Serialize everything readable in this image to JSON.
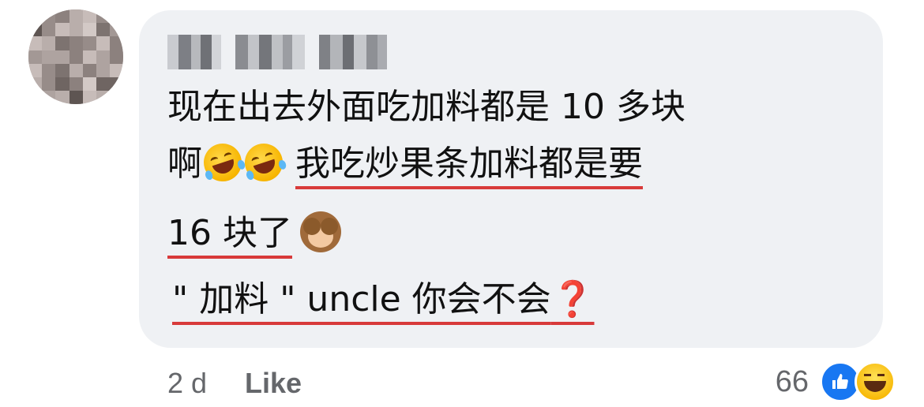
{
  "comment": {
    "author_name": "[blurred]",
    "lines": [
      {
        "text": "现在出去外面吃加料都是 10 多块"
      },
      {
        "pre": "啊",
        "emoji": "rolling-on-floor-laughing",
        "underlined": "我吃炒果条加料都是要"
      },
      {
        "underlined": "16 块了",
        "emoji": "see-no-evil-monkey"
      },
      {
        "underlined": " \" 加料 \" uncle 你会不会",
        "suffix": "❓"
      }
    ],
    "underline_color": "#d83a3a"
  },
  "footer": {
    "age": "2 d",
    "like_label": "Like",
    "reaction_count": "66",
    "reactions": [
      "like-icon",
      "haha-icon"
    ]
  },
  "colors": {
    "bubble": "#eff1f4",
    "meta_text": "#65676b",
    "like_blue": "#1877f2",
    "question_red": "#d52b2b"
  }
}
